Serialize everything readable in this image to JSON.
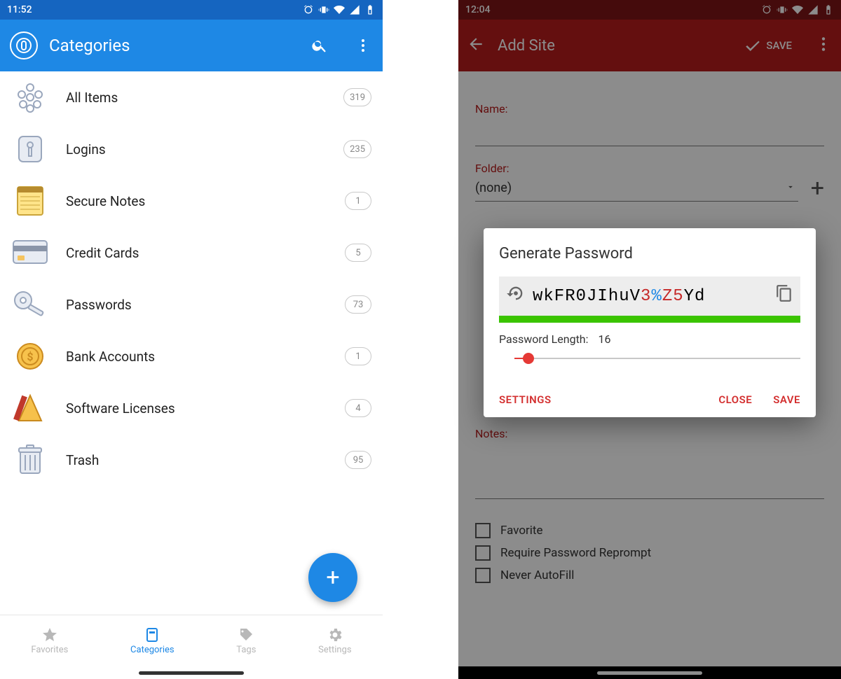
{
  "left": {
    "status_time": "11:52",
    "appbar": {
      "title": "Categories"
    },
    "categories": [
      {
        "label": "All Items",
        "count": "319"
      },
      {
        "label": "Logins",
        "count": "235"
      },
      {
        "label": "Secure Notes",
        "count": "1"
      },
      {
        "label": "Credit Cards",
        "count": "5"
      },
      {
        "label": "Passwords",
        "count": "73"
      },
      {
        "label": "Bank Accounts",
        "count": "1"
      },
      {
        "label": "Software Licenses",
        "count": "4"
      },
      {
        "label": "Trash",
        "count": "95"
      }
    ],
    "tabs": {
      "favorites": "Favorites",
      "categories": "Categories",
      "tags": "Tags",
      "settings": "Settings"
    }
  },
  "right": {
    "status_time": "12:04",
    "appbar": {
      "title": "Add Site",
      "save": "SAVE"
    },
    "form": {
      "name_label": "Name:",
      "folder_label": "Folder:",
      "folder_value": "(none)",
      "notes_label": "Notes:",
      "checkbox1": "Favorite",
      "checkbox2": "Require Password Reprompt",
      "checkbox3": "Never AutoFill"
    },
    "dialog": {
      "title": "Generate Password",
      "password_plain": "wkFR0JIhuV3%Z5Yd",
      "length_label": "Password Length:",
      "length_value": "16",
      "settings": "SETTINGS",
      "close": "CLOSE",
      "save": "SAVE"
    }
  }
}
